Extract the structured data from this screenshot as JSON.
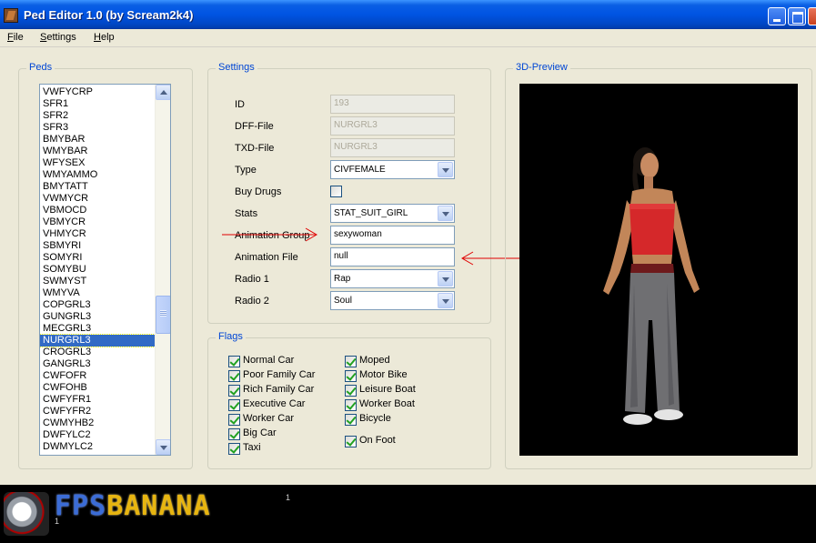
{
  "window": {
    "title": "Ped Editor 1.0 (by Scream2k4)"
  },
  "menu": [
    {
      "mnemonic": "F",
      "rest": "ile"
    },
    {
      "mnemonic": "S",
      "rest": "ettings"
    },
    {
      "mnemonic": "H",
      "rest": "elp"
    }
  ],
  "peds": {
    "group_title": "Peds",
    "items": [
      "VWFYCRP",
      "SFR1",
      "SFR2",
      "SFR3",
      "BMYBAR",
      "WMYBAR",
      "WFYSEX",
      "WMYAMMO",
      "BMYTATT",
      "VWMYCR",
      "VBMOCD",
      "VBMYCR",
      "VHMYCR",
      "SBMYRI",
      "SOMYRI",
      "SOMYBU",
      "SWMYST",
      "WMYVA",
      "COPGRL3",
      "GUNGRL3",
      "MECGRL3",
      "NURGRL3",
      "CROGRL3",
      "GANGRL3",
      "CWFOFR",
      "CWFOHB",
      "CWFYFR1",
      "CWFYFR2",
      "CWMYHB2",
      "DWFYLC2",
      "DWMYLC2"
    ],
    "selected": "NURGRL3"
  },
  "settings": {
    "group_title": "Settings",
    "id": {
      "label": "ID",
      "value": "193"
    },
    "dff": {
      "label": "DFF-File",
      "value": "NURGRL3"
    },
    "txd": {
      "label": "TXD-File",
      "value": "NURGRL3"
    },
    "type": {
      "label": "Type",
      "value": "CIVFEMALE"
    },
    "buy_drugs": {
      "label": "Buy Drugs",
      "checked": false
    },
    "stats": {
      "label": "Stats",
      "value": "STAT_SUIT_GIRL"
    },
    "anim_group": {
      "label": "Animation Group",
      "value": "sexywoman"
    },
    "anim_file": {
      "label": "Animation File",
      "value": "null"
    },
    "radio1": {
      "label": "Radio 1",
      "value": "Rap"
    },
    "radio2": {
      "label": "Radio 2",
      "value": "Soul"
    }
  },
  "flags": {
    "group_title": "Flags",
    "left": [
      "Normal Car",
      "Poor Family Car",
      "Rich Family Car",
      "Executive Car",
      "Worker Car",
      "Big Car",
      "Taxi"
    ],
    "right": [
      "Moped",
      "Motor Bike",
      "Leisure Boat",
      "Worker Boat",
      "Bicycle",
      "On Foot"
    ]
  },
  "preview": {
    "group_title": "3D-Preview"
  },
  "banner": {
    "logo_part1": "FPS",
    "logo_part2": "BANANA",
    "superscript": "1",
    "small": "1"
  },
  "colors": {
    "annotation_arrow": "#e00000",
    "selection": "#316ac5",
    "group_title": "#0046d5"
  }
}
